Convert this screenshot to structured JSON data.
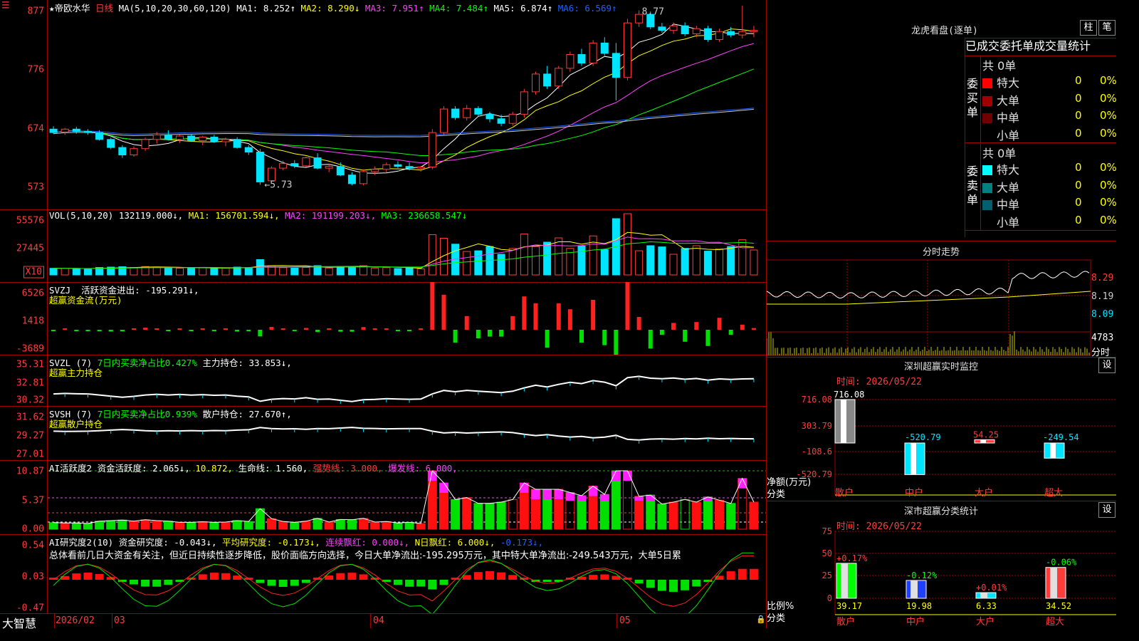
{
  "main": {
    "title": "★帝欧水华",
    "period": "日线",
    "ma_params": "MA(5,10,20,30,60,120)",
    "ma": [
      {
        "label": "MA1:",
        "value": "8.252↑",
        "color": "#ffffff"
      },
      {
        "label": "MA2:",
        "value": "8.290↓",
        "color": "#ffff00"
      },
      {
        "label": "MA3:",
        "value": "7.951↑",
        "color": "#ff40ff"
      },
      {
        "label": "MA4:",
        "value": "7.484↑",
        "color": "#00ff00"
      },
      {
        "label": "MA5:",
        "value": "6.874↑",
        "color": "#ffffff"
      },
      {
        "label": "MA6:",
        "value": "6.569↑",
        "color": "#2060ff"
      }
    ],
    "y_ticks": [
      "877",
      "776",
      "674",
      "573"
    ],
    "high_label": "8.77",
    "low_label": "←5.73",
    "menu_icon": "menu-icon",
    "ohlc": [
      [
        6.7,
        6.75,
        6.62,
        6.64
      ],
      [
        6.65,
        6.72,
        6.6,
        6.7
      ],
      [
        6.7,
        6.74,
        6.62,
        6.66
      ],
      [
        6.66,
        6.7,
        6.6,
        6.64
      ],
      [
        6.64,
        6.68,
        6.5,
        6.52
      ],
      [
        6.52,
        6.55,
        6.35,
        6.38
      ],
      [
        6.38,
        6.42,
        6.2,
        6.25
      ],
      [
        6.25,
        6.4,
        6.22,
        6.36
      ],
      [
        6.36,
        6.55,
        6.32,
        6.52
      ],
      [
        6.52,
        6.65,
        6.45,
        6.6
      ],
      [
        6.6,
        6.68,
        6.5,
        6.52
      ],
      [
        6.52,
        6.6,
        6.46,
        6.58
      ],
      [
        6.58,
        6.62,
        6.48,
        6.5
      ],
      [
        6.5,
        6.58,
        6.42,
        6.56
      ],
      [
        6.56,
        6.6,
        6.46,
        6.48
      ],
      [
        6.48,
        6.55,
        6.4,
        6.52
      ],
      [
        6.52,
        6.56,
        6.36,
        6.38
      ],
      [
        6.38,
        6.42,
        6.25,
        6.3
      ],
      [
        6.3,
        6.35,
        5.73,
        5.78
      ],
      [
        5.8,
        6.05,
        5.78,
        6.02
      ],
      [
        6.02,
        6.15,
        5.98,
        6.1
      ],
      [
        6.1,
        6.16,
        6.02,
        6.06
      ],
      [
        6.06,
        6.22,
        6.04,
        6.2
      ],
      [
        6.2,
        6.28,
        6.0,
        6.02
      ],
      [
        6.02,
        6.1,
        5.95,
        6.05
      ],
      [
        6.05,
        6.12,
        5.88,
        5.9
      ],
      [
        5.9,
        5.95,
        5.72,
        5.75
      ],
      [
        5.75,
        6.0,
        5.72,
        5.96
      ],
      [
        5.96,
        6.05,
        5.9,
        6.0
      ],
      [
        6.0,
        6.12,
        5.95,
        6.08
      ],
      [
        6.08,
        6.14,
        6.02,
        6.05
      ],
      [
        6.05,
        6.12,
        5.98,
        6.02
      ],
      [
        6.02,
        6.06,
        5.96,
        6.04
      ],
      [
        6.04,
        6.7,
        6.0,
        6.64
      ],
      [
        6.64,
        7.1,
        6.6,
        7.05
      ],
      [
        7.05,
        7.1,
        6.86,
        6.9
      ],
      [
        6.9,
        7.12,
        6.85,
        7.06
      ],
      [
        7.06,
        7.1,
        6.92,
        6.96
      ],
      [
        6.96,
        7.0,
        6.82,
        6.88
      ],
      [
        6.88,
        6.95,
        6.75,
        6.8
      ],
      [
        6.8,
        7.0,
        6.76,
        6.96
      ],
      [
        6.96,
        7.4,
        6.9,
        7.35
      ],
      [
        7.35,
        7.7,
        7.3,
        7.66
      ],
      [
        7.66,
        7.8,
        7.4,
        7.45
      ],
      [
        7.45,
        7.8,
        7.4,
        7.76
      ],
      [
        7.76,
        8.05,
        7.7,
        8.0
      ],
      [
        8.0,
        8.1,
        7.8,
        7.85
      ],
      [
        7.85,
        8.25,
        7.8,
        8.2
      ],
      [
        8.2,
        8.3,
        7.98,
        8.02
      ],
      [
        8.02,
        8.2,
        7.2,
        7.6
      ],
      [
        7.6,
        8.62,
        7.55,
        8.55
      ],
      [
        8.55,
        8.77,
        8.48,
        8.7
      ],
      [
        8.7,
        8.75,
        8.44,
        8.48
      ],
      [
        8.48,
        8.55,
        8.38,
        8.42
      ],
      [
        8.42,
        8.56,
        8.36,
        8.5
      ],
      [
        8.5,
        8.56,
        8.32,
        8.36
      ],
      [
        8.36,
        8.5,
        8.3,
        8.45
      ],
      [
        8.45,
        8.5,
        8.22,
        8.26
      ],
      [
        8.26,
        8.45,
        8.22,
        8.4
      ],
      [
        8.4,
        8.48,
        8.3,
        8.34
      ],
      [
        8.34,
        8.85,
        8.28,
        8.4
      ],
      [
        8.4,
        8.5,
        8.3,
        8.42
      ]
    ]
  },
  "vol": {
    "params": "VOL(5,10,20)",
    "value": "132119.000↓,",
    "ma": [
      {
        "label": "MA1:",
        "value": "156701.594↓,",
        "color": "#ffff00"
      },
      {
        "label": "MA2:",
        "value": "191199.203↓,",
        "color": "#ff40ff"
      },
      {
        "label": "MA3:",
        "value": "236658.547↓",
        "color": "#00ff00"
      }
    ],
    "y_ticks": [
      "55576",
      "27445"
    ],
    "unit": "X10"
  },
  "svzj": {
    "name": "SVZJ",
    "label": "活跃资金进出:",
    "value": "-195.291↓,",
    "subtitle": "超赢资金流(万元)",
    "y_ticks": [
      "6526",
      "1418",
      "-3689"
    ]
  },
  "svzl": {
    "name": "SVZL",
    "param": "(7)",
    "label1": "7日内买卖净占比0.427%",
    "label2": "主力持仓:",
    "value": "33.853↓,",
    "subtitle": "超赢主力持仓",
    "y_ticks": [
      "35.31",
      "32.81",
      "30.32"
    ]
  },
  "svsh": {
    "name": "SVSH",
    "param": "(7)",
    "label1": "7日内买卖净占比0.939%",
    "label2": "散户持仓:",
    "value": "27.670↑,",
    "subtitle": "超赢散户持仓",
    "y_ticks": [
      "31.62",
      "29.27",
      "27.01"
    ]
  },
  "ai1": {
    "name": "AI活跃度2",
    "label": "资金活跃度:",
    "value": "2.065↓,",
    "value2": "10.872,",
    "life": "生命线: 1.560,",
    "strong": "强势线: 3.000,",
    "burst": "爆发线: 6.000,",
    "y_ticks": [
      "10.87",
      "5.37",
      "0.00"
    ]
  },
  "ai2": {
    "name": "AI研究度2(10)",
    "label": "资金研究度:",
    "value": "-0.043↓,",
    "avg": "平均研究度: -0.173↓,",
    "cont": "连续飘红: 0.000↓,",
    "nday": "N日飘红: 6.000↓,",
    "last": "-0.173↓,",
    "summary": "总体看前几日大资金有关注，但近日持续性逐步降低，股价面临方向选择，今日大单净流出:-195.295万元，其中特大单净流出:-249.543万元，大单5日累",
    "y_ticks": [
      "0.54",
      "0.03",
      "-0.47"
    ]
  },
  "bottom": {
    "brand": "大智慧",
    "dates": [
      "2026/02",
      "03",
      "04",
      "05"
    ],
    "lock_icon": "lock-icon"
  },
  "lhb": {
    "title": "龙虎看盘(逐单)",
    "btn1": "柱",
    "btn2": "笔",
    "tabs": [
      "已成交",
      "委托单",
      "成交量",
      "统计"
    ],
    "buy_label": "委买单",
    "sell_label": "委卖单",
    "buy_total": "共 0单",
    "sell_total": "共 0单",
    "buy_rows": [
      {
        "name": "特大",
        "count": "0",
        "pct": "0%",
        "color": "#ff0000"
      },
      {
        "name": "大单",
        "count": "0",
        "pct": "0%",
        "color": "#a00000"
      },
      {
        "name": "中单",
        "count": "0",
        "pct": "0%",
        "color": "#700000"
      },
      {
        "name": "小单",
        "count": "0",
        "pct": "0%",
        "color": "#000000"
      }
    ],
    "sell_rows": [
      {
        "name": "特大",
        "count": "0",
        "pct": "0%",
        "color": "#00ffff"
      },
      {
        "name": "大单",
        "count": "0",
        "pct": "0%",
        "color": "#008080"
      },
      {
        "name": "中单",
        "count": "0",
        "pct": "0%",
        "color": "#006070"
      },
      {
        "name": "小单",
        "count": "0",
        "pct": "0%",
        "color": "#000000"
      }
    ]
  },
  "intraday": {
    "title": "分时走势",
    "y_ticks": [
      "8.29",
      "8.19",
      "8.09"
    ],
    "vol_label": "4783",
    "vol_unit": "分时"
  },
  "monitor": {
    "title": "深圳超赢实时监控",
    "btn": "设",
    "time": "时间: 2026/05/22",
    "y_ticks": [
      "716.08",
      "303.79",
      "-108.6",
      "-520.79"
    ],
    "axis_label": "净额(万元)",
    "cat_label": "分类",
    "categories": [
      "散户",
      "中户",
      "大户",
      "超大"
    ],
    "values": [
      "716.08",
      "-520.79",
      "54.25",
      "-249.54"
    ]
  },
  "stats": {
    "title": "深市超赢分类统计",
    "btn": "设",
    "time": "时间: 2026/05/22",
    "y_ticks": [
      "75",
      "50",
      "25",
      "0"
    ],
    "axis_label": "比例%",
    "cat_label": "分类",
    "categories": [
      "散户",
      "中户",
      "大户",
      "超大"
    ],
    "values": [
      "39.17",
      "19.98",
      "6.33",
      "34.52"
    ],
    "changes": [
      "+0.17%",
      "-0.12%",
      "+0.01%",
      "-0.06%"
    ]
  }
}
